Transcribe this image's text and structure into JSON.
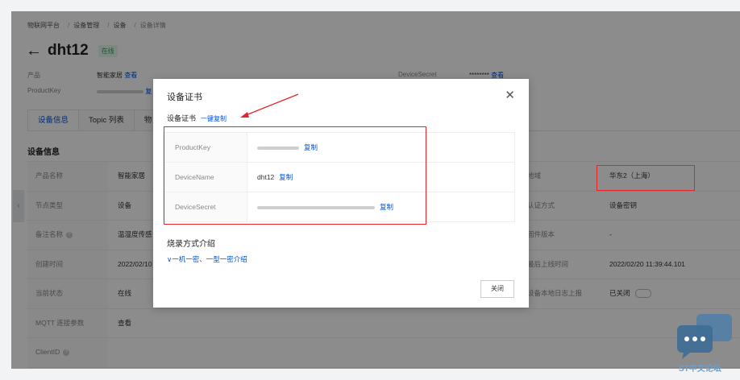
{
  "breadcrumb": {
    "items": [
      "物联网平台",
      "设备管理",
      "设备",
      "设备详情"
    ],
    "sep": "/"
  },
  "device": {
    "name": "dht12",
    "status": "在线"
  },
  "meta": {
    "product_label": "产品",
    "product_value": "智能家居",
    "product_link": "查看",
    "productkey_label": "ProductKey",
    "productkey_copy": "复",
    "devicesecret_label": "DeviceSecret",
    "devicesecret_value": "********",
    "devicesecret_link": "查看"
  },
  "tabs": [
    "设备信息",
    "Topic 列表",
    "物"
  ],
  "section_title": "设备信息",
  "info_rows": [
    {
      "label": "产品名称",
      "value": "智能家居",
      "label2": "地域",
      "value2": "华东2（上海）"
    },
    {
      "label": "节点类型",
      "value": "设备",
      "label2": "认证方式",
      "value2": "设备密钥"
    },
    {
      "label": "备注名称",
      "value": "温湿度传感",
      "label2": "固件版本",
      "value2": "-"
    },
    {
      "label": "创建时间",
      "value": "2022/02/10",
      "label2": "最后上线时间",
      "value2": "2022/02/20 11:39:44.101"
    },
    {
      "label": "当前状态",
      "value": "在线",
      "label2": "设备本地日志上报",
      "value2": "已关闭"
    },
    {
      "label": "MQTT 连接参数",
      "value": "查看",
      "label2": "",
      "value2": ""
    },
    {
      "label": "ClientID",
      "value": "",
      "label2": "",
      "value2": ""
    }
  ],
  "modal": {
    "title": "设备证书",
    "cert_label": "设备证书",
    "copy_all": "一键复制",
    "rows": [
      {
        "key": "ProductKey",
        "value": "",
        "copy": "复制"
      },
      {
        "key": "DeviceName",
        "value": "dht12",
        "copy": "复制"
      },
      {
        "key": "DeviceSecret",
        "value": "",
        "copy": "复制"
      }
    ],
    "burn_title": "烧录方式介绍",
    "burn_link": "一机一密、一型一密介绍",
    "close_button": "关闭"
  },
  "watermark": {
    "text": "ST中文论坛"
  },
  "colors": {
    "accent": "#0052d9",
    "annotation_red": "#e8232a",
    "online_green": "#29a35a"
  }
}
